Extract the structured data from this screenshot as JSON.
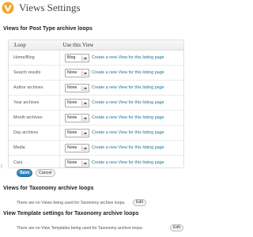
{
  "header": {
    "title": "Views Settings",
    "logo_icon": "views-logo-icon"
  },
  "post_type_section": {
    "heading": "Views for Post Type archive loops",
    "columns": {
      "loop": "Loop",
      "use": "Use this View"
    },
    "rows": [
      {
        "name": "Home/Blog",
        "selected": "Blog",
        "link": "Create a new View for this listing page"
      },
      {
        "name": "Search results",
        "selected": "None",
        "link": "Create a new View for this listing page"
      },
      {
        "name": "Author archives",
        "selected": "None",
        "link": "Create a new View for this listing page"
      },
      {
        "name": "Year archives",
        "selected": "None",
        "link": "Create a new View for this listing page"
      },
      {
        "name": "Month archives",
        "selected": "None",
        "link": "Create a new View for this listing page"
      },
      {
        "name": "Day archives",
        "selected": "None",
        "link": "Create a new View for this listing page"
      },
      {
        "name": "Media",
        "selected": "None",
        "link": "Create a new View for this listing page"
      },
      {
        "name": "Cars",
        "selected": "None",
        "link": "Create a new View for this listing page"
      }
    ],
    "save_label": "Save",
    "cancel_label": "Cancel",
    "marker": ")"
  },
  "taxonomy_section": {
    "heading": "Views for Taxonomy archive loops",
    "note": "There are no Views being used for Taxonomy archive loops.",
    "edit_label": "Edit"
  },
  "template_section": {
    "heading": "View Template settings for Taxonomy archive loops",
    "note": "There are no View Templates being used for Taxonomy archive loops.",
    "edit_label": "Edit"
  },
  "colors": {
    "accent": "#21759b",
    "save_button": "#2a83c1",
    "logo": "#f0a830"
  }
}
